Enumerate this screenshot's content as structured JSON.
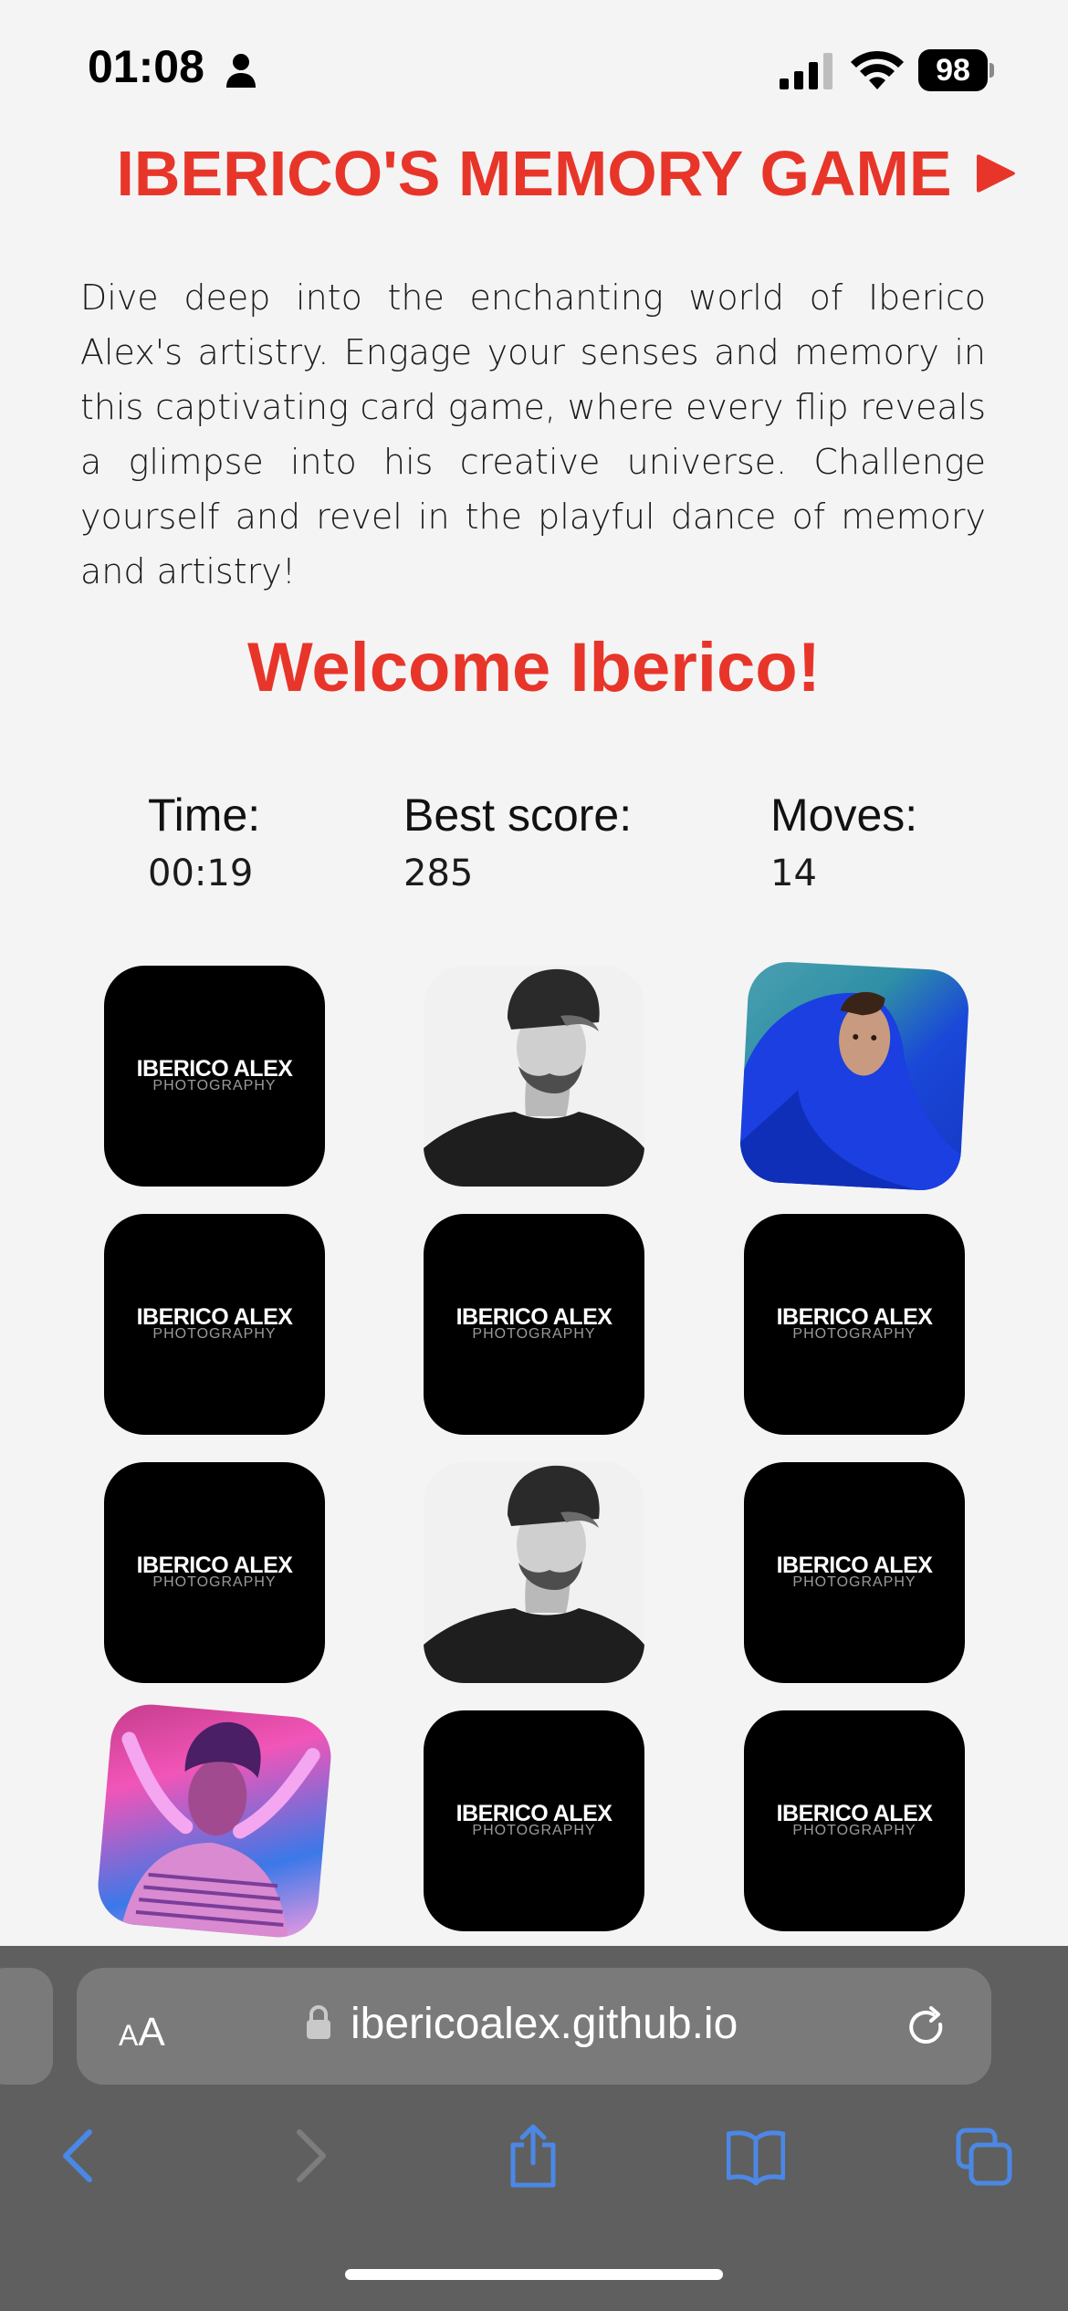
{
  "status_bar": {
    "time": "01:08",
    "battery": "98"
  },
  "header": {
    "title": "IBERICO'S MEMORY GAME",
    "description": "Dive deep into the enchanting world of Iberico Alex's artistry. Engage your senses and memory in this captivating card game, where every flip reveals a glimpse into his creative universe. Challenge yourself and revel in the playful dance of memory and artistry!"
  },
  "welcome": "Welcome Iberico!",
  "stats": {
    "time_label": "Time:",
    "time_value": "00:19",
    "best_label": "Best score:",
    "best_value": "285",
    "moves_label": "Moves:",
    "moves_value": "14"
  },
  "card_back": {
    "brand": "IBERICO ALEX",
    "sub": "PHOTOGRAPHY"
  },
  "cards": [
    {
      "state": "face-down"
    },
    {
      "state": "face-up",
      "image": "man-beanie-bw"
    },
    {
      "state": "face-up",
      "image": "man-blue-hood"
    },
    {
      "state": "face-down"
    },
    {
      "state": "face-down"
    },
    {
      "state": "face-down"
    },
    {
      "state": "face-down"
    },
    {
      "state": "face-up",
      "image": "man-beanie-bw"
    },
    {
      "state": "face-down"
    },
    {
      "state": "face-up",
      "image": "woman-pink-neon"
    },
    {
      "state": "face-down"
    },
    {
      "state": "face-down"
    }
  ],
  "browser": {
    "text_size_small": "A",
    "text_size_big": "A",
    "url": "ibericoalex.github.io"
  },
  "colors": {
    "accent": "#e8352a",
    "background": "#f4f4f4",
    "toolbar": "#5f5f5f",
    "toolbar_icons": "#4b88e6"
  },
  "icons": [
    "person-icon",
    "signal-icon",
    "wifi-icon",
    "play-icon",
    "lock-icon",
    "reload-icon",
    "back-icon",
    "forward-icon",
    "share-icon",
    "bookmarks-icon",
    "tabs-icon"
  ]
}
